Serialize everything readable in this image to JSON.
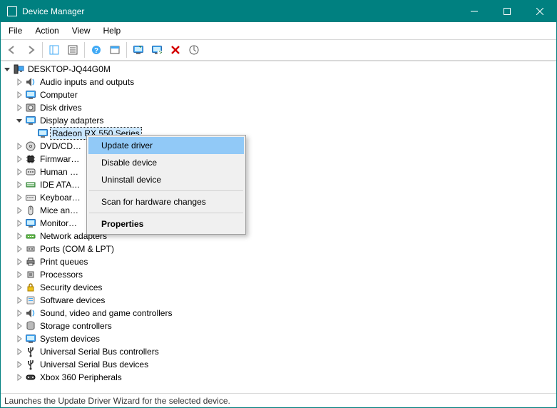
{
  "window": {
    "title": "Device Manager"
  },
  "menus": {
    "file": "File",
    "action": "Action",
    "view": "View",
    "help": "Help"
  },
  "root": {
    "name": "DESKTOP-JQ44G0M"
  },
  "categories": [
    {
      "label": "Audio inputs and outputs",
      "icon": "audio",
      "expanded": false,
      "children": []
    },
    {
      "label": "Computer",
      "icon": "monitor",
      "expanded": false,
      "children": []
    },
    {
      "label": "Disk drives",
      "icon": "disk",
      "expanded": false,
      "children": []
    },
    {
      "label": "Display adapters",
      "icon": "monitor",
      "expanded": true,
      "children": [
        {
          "label": "Radeon RX 550 Series",
          "icon": "monitor",
          "selected": true
        }
      ]
    },
    {
      "label": "DVD/CD…",
      "full": "DVD/CD-ROM drives",
      "icon": "optical",
      "expanded": false,
      "children": []
    },
    {
      "label": "Firmwar…",
      "full": "Firmware",
      "icon": "chip",
      "expanded": false,
      "children": []
    },
    {
      "label": "Human …",
      "full": "Human Interface Devices",
      "icon": "hid",
      "expanded": false,
      "children": []
    },
    {
      "label": "IDE ATA…",
      "full": "IDE ATA/ATAPI controllers",
      "icon": "ide",
      "expanded": false,
      "children": []
    },
    {
      "label": "Keyboar…",
      "full": "Keyboards",
      "icon": "keyboard",
      "expanded": false,
      "children": []
    },
    {
      "label": "Mice an…",
      "full": "Mice and other pointing devices",
      "icon": "mouse",
      "expanded": false,
      "children": []
    },
    {
      "label": "Monitor…",
      "full": "Monitors",
      "icon": "monitor",
      "expanded": false,
      "children": []
    },
    {
      "label": "Network adapters",
      "icon": "network",
      "expanded": false,
      "children": []
    },
    {
      "label": "Ports (COM & LPT)",
      "icon": "port",
      "expanded": false,
      "children": []
    },
    {
      "label": "Print queues",
      "icon": "printer",
      "expanded": false,
      "children": []
    },
    {
      "label": "Processors",
      "icon": "cpu",
      "expanded": false,
      "children": []
    },
    {
      "label": "Security devices",
      "icon": "lock",
      "expanded": false,
      "children": []
    },
    {
      "label": "Software devices",
      "icon": "soft",
      "expanded": false,
      "children": []
    },
    {
      "label": "Sound, video and game controllers",
      "icon": "audio",
      "expanded": false,
      "children": []
    },
    {
      "label": "Storage controllers",
      "icon": "storage",
      "expanded": false,
      "children": []
    },
    {
      "label": "System devices",
      "icon": "monitor",
      "expanded": false,
      "children": []
    },
    {
      "label": "Universal Serial Bus controllers",
      "icon": "usb",
      "expanded": false,
      "children": []
    },
    {
      "label": "Universal Serial Bus devices",
      "icon": "usb",
      "expanded": false,
      "children": []
    },
    {
      "label": "Xbox 360 Peripherals",
      "icon": "gamepad",
      "expanded": false,
      "children": []
    }
  ],
  "context_menu": {
    "items": [
      {
        "label": "Update driver",
        "highlight": true
      },
      {
        "label": "Disable device"
      },
      {
        "label": "Uninstall device"
      },
      {
        "sep": true
      },
      {
        "label": "Scan for hardware changes"
      },
      {
        "sep": true
      },
      {
        "label": "Properties",
        "bold": true
      }
    ]
  },
  "status_text": "Launches the Update Driver Wizard for the selected device.",
  "truncate_after_index": 3
}
